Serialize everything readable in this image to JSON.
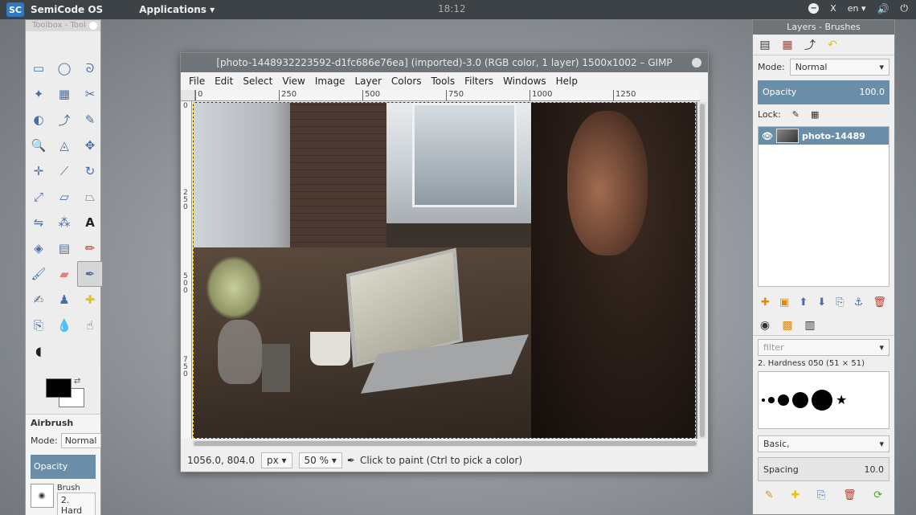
{
  "topbar": {
    "logo": "SC",
    "os_name": "SemiCode OS",
    "applications": "Applications ▾",
    "clock": "18:12",
    "language": "en",
    "lang_arrow": "▾"
  },
  "toolbox": {
    "title": "Toolbox - Tool",
    "options_title": "Airbrush",
    "mode_label": "Mode:",
    "mode_value": "Normal",
    "opacity_label": "Opacity",
    "brush_label": "Brush",
    "brush_value": "2. Hard"
  },
  "gimp": {
    "title": "[photo-1448932223592-d1fc686e76ea] (imported)-3.0 (RGB color, 1 layer) 1500x1002 – GIMP",
    "menu": [
      "File",
      "Edit",
      "Select",
      "View",
      "Image",
      "Layer",
      "Colors",
      "Tools",
      "Filters",
      "Windows",
      "Help"
    ],
    "ruler_h": [
      "0",
      "250",
      "500",
      "750",
      "1000",
      "1250"
    ],
    "ruler_v": [
      "0",
      "250",
      "500",
      "750"
    ],
    "coords": "1056.0, 804.0",
    "unit": "px",
    "zoom": "50 %",
    "status_msg": "Click to paint (Ctrl to pick a color)"
  },
  "dock": {
    "title": "Layers - Brushes",
    "mode_label": "Mode:",
    "mode_value": "Normal",
    "opacity_label": "Opacity",
    "opacity_value": "100.0",
    "lock_label": "Lock:",
    "layer_name": "photo-14489",
    "filter_placeholder": "filter",
    "brush_name": "2. Hardness 050 (51 × 51)",
    "preset": "Basic,",
    "spacing_label": "Spacing",
    "spacing_value": "10.0"
  }
}
